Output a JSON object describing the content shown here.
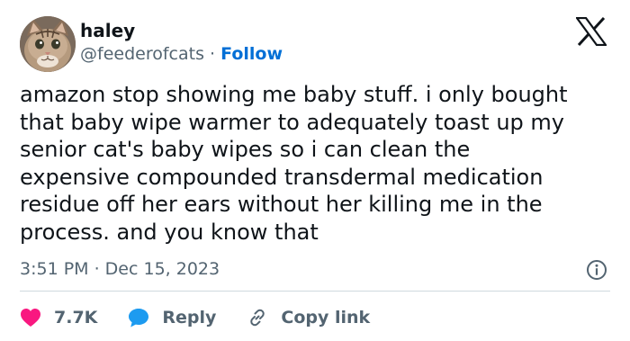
{
  "author": {
    "name": "haley",
    "handle": "@feederofcats",
    "separator": "·",
    "follow_label": "Follow"
  },
  "tweet": {
    "text": "amazon stop showing me baby stuff. i only bought\nthat baby wipe warmer to adequately toast up my\nsenior cat's baby wipes so i can clean the\nexpensive compounded transdermal medication\nresidue off her ears without her killing me in the\nprocess. and you know that",
    "timestamp": "3:51 PM · Dec 15, 2023"
  },
  "actions": {
    "likes_count": "7.7K",
    "reply_label": "Reply",
    "copy_link_label": "Copy link"
  },
  "colors": {
    "like": "#f91880",
    "reply": "#1d9bf0",
    "link": "#006fd6",
    "muted": "#536471"
  },
  "icons": {
    "brand": "x-logo-icon",
    "info": "info-icon",
    "like": "heart-icon",
    "reply": "speech-bubble-icon",
    "copy": "link-icon"
  }
}
